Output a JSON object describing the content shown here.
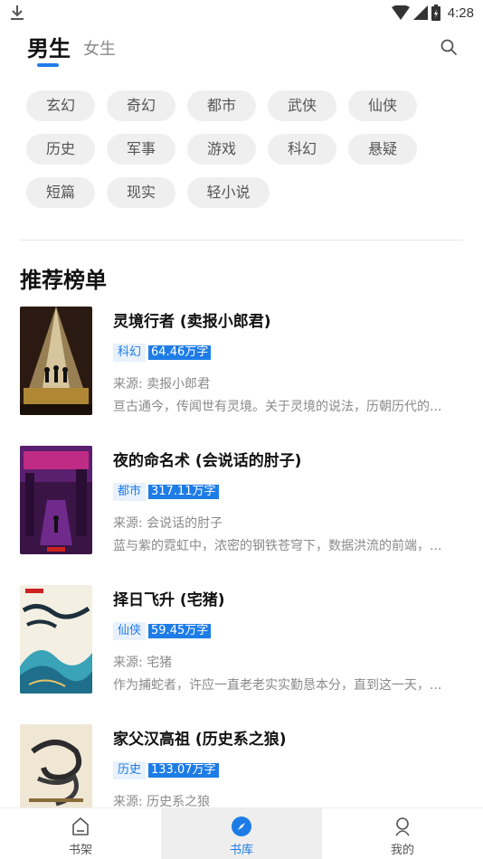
{
  "status_bar": {
    "time": "4:28",
    "icons": [
      "download-icon",
      "wifi-icon",
      "signal-icon",
      "battery-icon"
    ]
  },
  "header": {
    "tab_male": "男生",
    "tab_female": "女生",
    "active_tab": "男生",
    "search_icon": "search-icon"
  },
  "genres": [
    {
      "label": "玄幻"
    },
    {
      "label": "奇幻"
    },
    {
      "label": "都市"
    },
    {
      "label": "武侠"
    },
    {
      "label": "仙侠"
    },
    {
      "label": "历史"
    },
    {
      "label": "军事"
    },
    {
      "label": "游戏"
    },
    {
      "label": "科幻"
    },
    {
      "label": "悬疑"
    },
    {
      "label": "短篇"
    },
    {
      "label": "现实"
    },
    {
      "label": "轻小说"
    }
  ],
  "section_title": "推荐榜单",
  "books": [
    {
      "title": "灵境行者 (卖报小郎君)",
      "category": "科幻",
      "words": "64.46万字",
      "source": "来源: 卖报小郎君",
      "desc": "亘古通今，传闻世有灵境。关于灵境的说法，历朝历代的..."
    },
    {
      "title": "夜的命名术 (会说话的肘子)",
      "category": "都市",
      "words": "317.11万字",
      "source": "来源: 会说话的肘子",
      "desc": "蓝与紫的霓虹中，浓密的钢铁苍穹下，数据洪流的前端，..."
    },
    {
      "title": "择日飞升 (宅猪)",
      "category": "仙侠",
      "words": "59.45万字",
      "source": "来源: 宅猪",
      "desc": "作为捕蛇者，许应一直老老实实勤恳本分，直到这一天，..."
    },
    {
      "title": "家父汉高祖 (历史系之狼)",
      "category": "历史",
      "words": "133.07万字",
      "source": "来源: 历史系之狼",
      "desc": ""
    }
  ],
  "bottom_nav": [
    {
      "label": "书架",
      "icon": "bookshelf-icon",
      "active": false
    },
    {
      "label": "书库",
      "icon": "compass-icon",
      "active": true
    },
    {
      "label": "我的",
      "icon": "profile-icon",
      "active": false
    }
  ],
  "colors": {
    "accent": "#1e7ce6",
    "chip_bg": "#efefef",
    "muted_text": "#8a8a8a"
  }
}
